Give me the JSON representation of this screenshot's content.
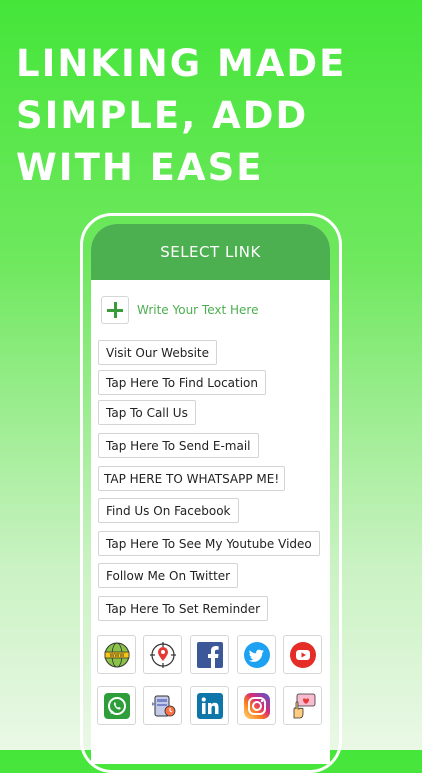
{
  "headline": {
    "line1": "LINKING MADE",
    "line2": "SIMPLE, ADD",
    "line3": "WITH EASE"
  },
  "screen": {
    "title": "SELECT LINK",
    "add_text": "Write Your Text Here"
  },
  "links": [
    "Visit Our Website",
    "Tap Here To Find Location",
    "Tap To Call Us",
    "Tap Here To Send E-mail",
    "TAP HERE TO WHATSAPP ME!",
    "Find Us On Facebook",
    "Tap Here To See My Youtube Video",
    "Follow Me On Twitter",
    "Tap Here To Set Reminder"
  ],
  "icons": [
    "www-globe-icon",
    "location-pin-icon",
    "facebook-icon",
    "twitter-icon",
    "youtube-icon",
    "whatsapp-icon",
    "reminder-icon",
    "linkedin-icon",
    "instagram-icon",
    "tap-hand-icon"
  ],
  "colors": {
    "accent": "#4caf50",
    "background_top": "#45e63a",
    "facebook": "#3b5998",
    "twitter": "#1da1f2",
    "youtube": "#e52d27",
    "whatsapp": "#2e9e3a",
    "linkedin": "#0e76a8"
  }
}
